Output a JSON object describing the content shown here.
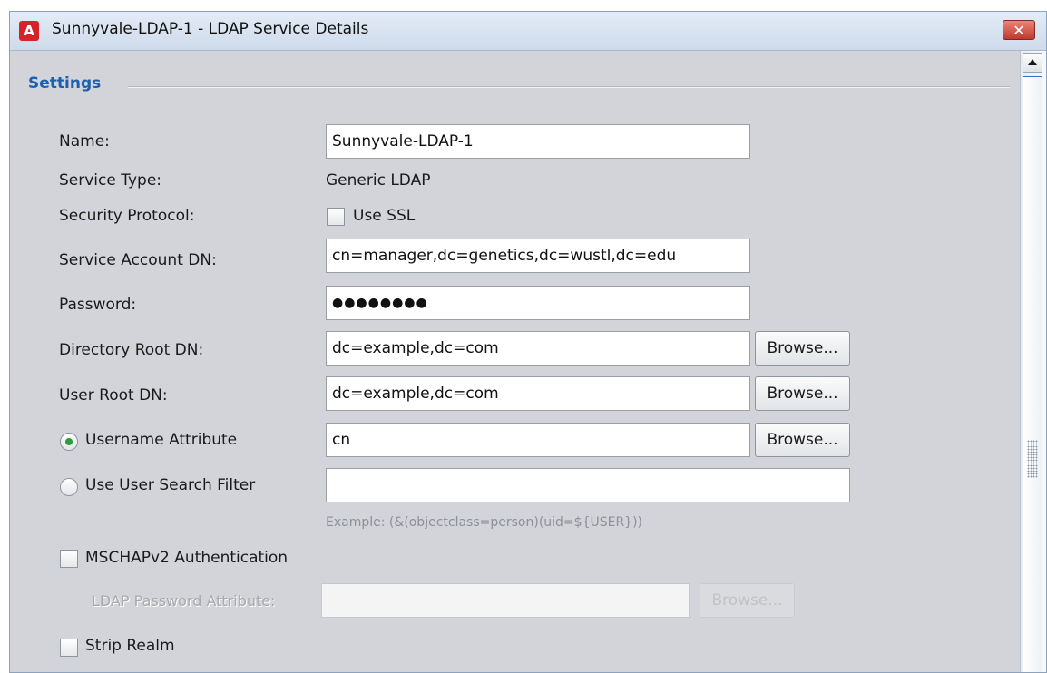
{
  "window": {
    "icon_letter": "A",
    "title": "Sunnyvale-LDAP-1 - LDAP Service Details",
    "close_glyph": "✕"
  },
  "section": {
    "title": "Settings"
  },
  "fields": {
    "name": {
      "label": "Name:",
      "value": "Sunnyvale-LDAP-1"
    },
    "service_type": {
      "label": "Service Type:",
      "value": "Generic LDAP"
    },
    "security_protocol": {
      "label": "Security Protocol:",
      "checkbox_label": "Use SSL",
      "checked": false
    },
    "service_account_dn": {
      "label": "Service Account DN:",
      "value": "cn=manager,dc=genetics,dc=wustl,dc=edu"
    },
    "password": {
      "label": "Password:",
      "value": "●●●●●●●●"
    },
    "directory_root_dn": {
      "label": "Directory Root DN:",
      "value": "dc=example,dc=com",
      "button": "Browse..."
    },
    "user_root_dn": {
      "label": "User Root DN:",
      "value": "dc=example,dc=com",
      "button": "Browse..."
    },
    "username_attribute": {
      "label": "Username Attribute",
      "value": "cn",
      "button": "Browse...",
      "selected": true
    },
    "user_search_filter": {
      "label": "Use User Search Filter",
      "value": "",
      "selected": false,
      "hint": "Example: (&(objectclass=person)(uid=${USER}))"
    },
    "mschapv2": {
      "label": "MSCHAPv2 Authentication",
      "checked": false
    },
    "ldap_password_attribute": {
      "label": "LDAP Password Attribute:",
      "value": "",
      "button": "Browse..."
    },
    "strip_realm": {
      "label": "Strip Realm",
      "checked": false
    }
  },
  "colors": {
    "section_title": "#1c5fb0",
    "radio_selected": "#2e9c3e",
    "close_button": "#c1392b",
    "window_bg": "#d2d4d9"
  },
  "icons": {
    "app": "app-logo-icon",
    "close": "close-icon",
    "scroll_up": "arrow-up-icon"
  }
}
